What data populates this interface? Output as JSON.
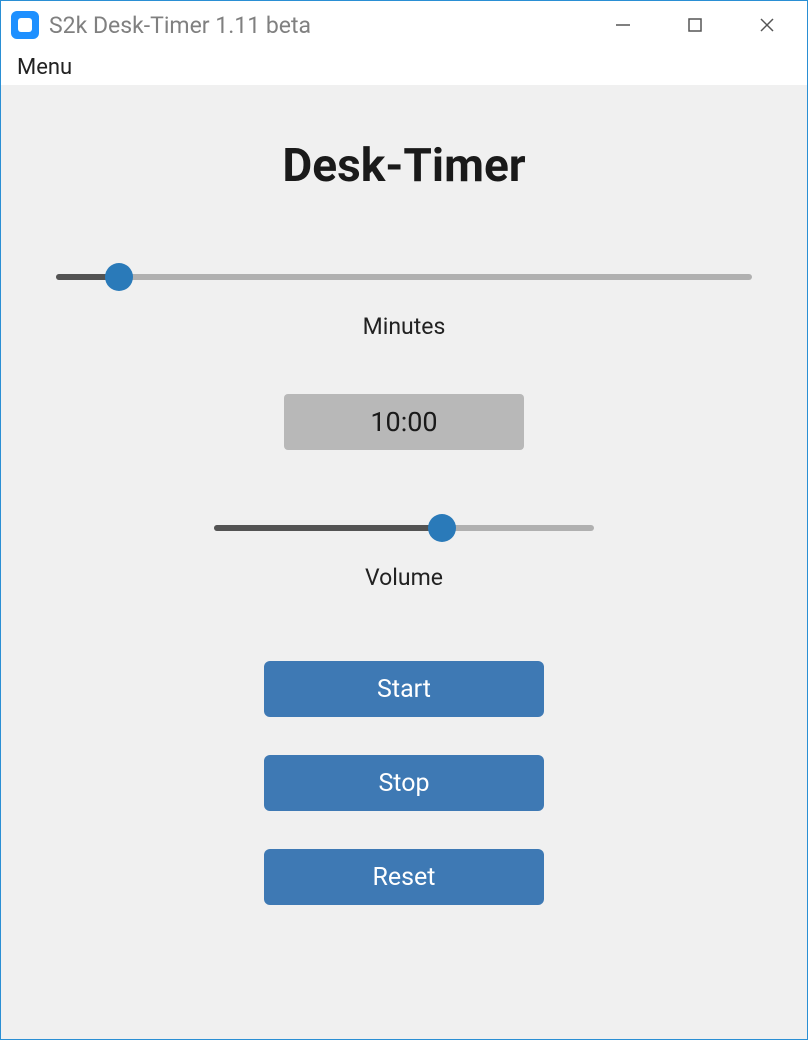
{
  "window": {
    "title": "S2k Desk-Timer 1.11 beta"
  },
  "menubar": {
    "menu_label": "Menu"
  },
  "app": {
    "heading": "Desk-Timer",
    "minutes_label": "Minutes",
    "minutes_slider_percent": 9,
    "time_display": "10:00",
    "volume_label": "Volume",
    "volume_slider_percent": 60,
    "buttons": {
      "start": "Start",
      "stop": "Stop",
      "reset": "Reset"
    }
  },
  "colors": {
    "accent": "#2a7ab9",
    "button": "#3e79b4",
    "panel": "#f0f0f0"
  }
}
